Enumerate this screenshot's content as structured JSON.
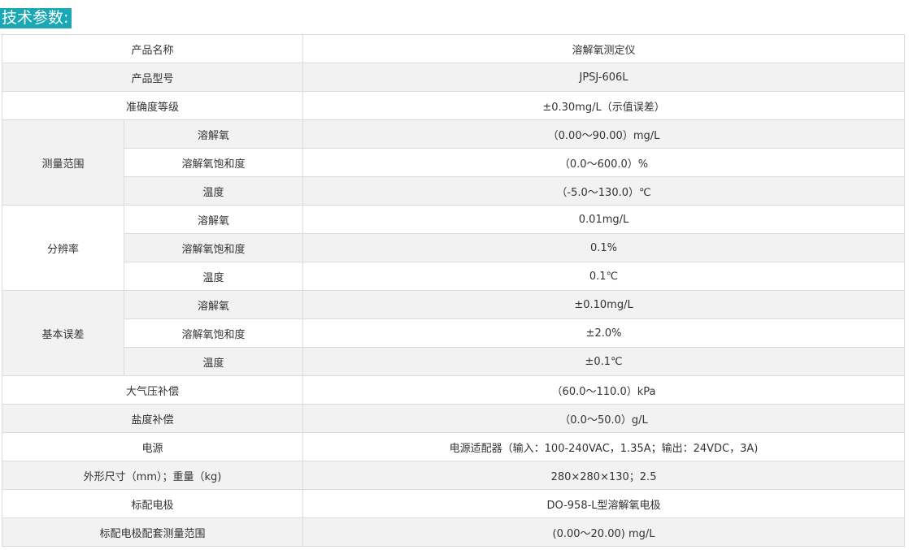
{
  "heading": "技术参数:",
  "rows": [
    {
      "label": "产品名称",
      "value": "溶解氧测定仪"
    },
    {
      "label": "产品型号",
      "value": "JPSJ-606L"
    },
    {
      "label": "准确度等级",
      "value": "±0.30mg/L（示值误差）"
    },
    {
      "group": "测量范围",
      "label": "溶解氧",
      "value": "（0.00～90.00）mg/L"
    },
    {
      "label": "溶解氧饱和度",
      "value": "（0.0～600.0）%"
    },
    {
      "label": "温度",
      "value": "（-5.0～130.0）℃"
    },
    {
      "group": "分辨率",
      "label": "溶解氧",
      "value": "0.01mg/L"
    },
    {
      "label": "溶解氧饱和度",
      "value": "0.1%"
    },
    {
      "label": "温度",
      "value": "0.1℃"
    },
    {
      "group": "基本误差",
      "label": "溶解氧",
      "value": "±0.10mg/L"
    },
    {
      "label": "溶解氧饱和度",
      "value": "±2.0%"
    },
    {
      "label": "温度",
      "value": "±0.1℃"
    },
    {
      "label": "大气压补偿",
      "value": "（60.0～110.0）kPa"
    },
    {
      "label": "盐度补偿",
      "value": "（0.0～50.0）g/L"
    },
    {
      "label": "电源",
      "value": "电源适配器（输入：100-240VAC，1.35A；输出：24VDC，3A)"
    },
    {
      "label": "外形尺寸（mm）；重量（kg)",
      "value": "280×280×130；2.5"
    },
    {
      "label": "标配电极",
      "value": "DO-958-L型溶解氧电极"
    },
    {
      "label": "标配电极配套测量范围",
      "value": "(0.00～20.00) mg/L"
    }
  ]
}
